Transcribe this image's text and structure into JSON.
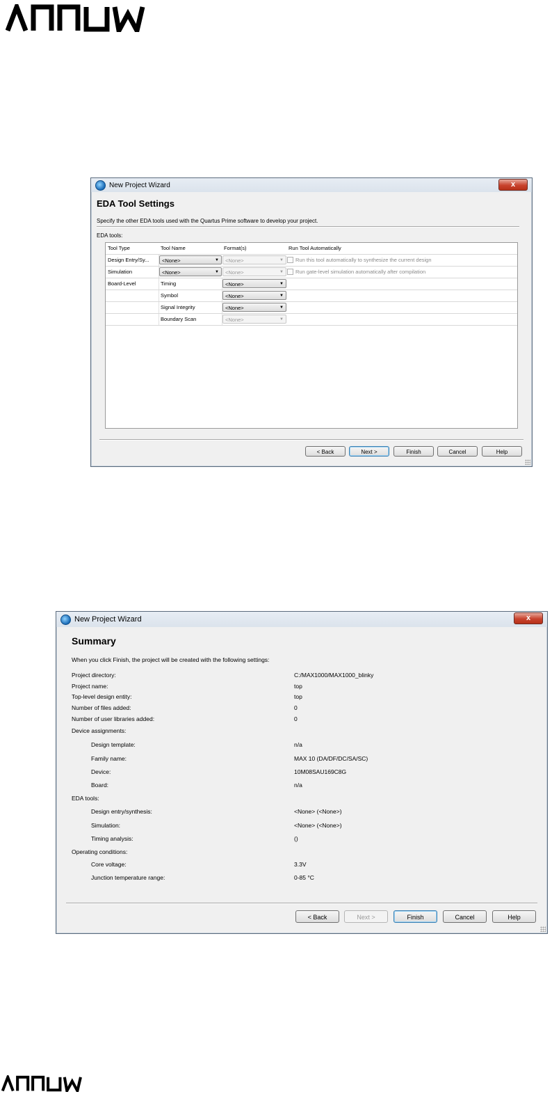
{
  "brand": {
    "logo_text": "ARROW"
  },
  "eda_window": {
    "title": "New Project Wizard",
    "close_label": "x",
    "heading": "EDA Tool Settings",
    "description": "Specify the other EDA tools used with the Quartus Prime software to develop your project.",
    "section_label": "EDA tools:",
    "columns": [
      "Tool Type",
      "Tool Name",
      "Format(s)",
      "Run Tool Automatically"
    ],
    "rows": [
      {
        "type": "Design Entry/Sy...",
        "name": "<None>",
        "format": "<None>",
        "run": "Run this tool automatically to synthesize the current design"
      },
      {
        "type": "Simulation",
        "name": "<None>",
        "format": "<None>",
        "run": "Run gate-level simulation automatically after compilation"
      },
      {
        "type": "Board-Level",
        "name": "Timing",
        "format": "<None>",
        "run": ""
      },
      {
        "type": "",
        "name": "Symbol",
        "format": "<None>",
        "run": ""
      },
      {
        "type": "",
        "name": "Signal Integrity",
        "format": "<None>",
        "run": ""
      },
      {
        "type": "",
        "name": "Boundary Scan",
        "format": "<None>",
        "run": ""
      }
    ],
    "buttons": {
      "back": "< Back",
      "next": "Next >",
      "finish": "Finish",
      "cancel": "Cancel",
      "help": "Help"
    }
  },
  "summary_window": {
    "title": "New Project Wizard",
    "close_label": "x",
    "heading": "Summary",
    "intro": "When you click Finish, the project will be created with the following settings:",
    "items": [
      {
        "label": "Project directory:",
        "value": "C:/MAX1000/MAX1000_blinky"
      },
      {
        "label": "Project name:",
        "value": "top"
      },
      {
        "label": "Top-level design entity:",
        "value": "top"
      },
      {
        "label": "Number of files added:",
        "value": "0"
      },
      {
        "label": "Number of user libraries added:",
        "value": "0"
      },
      {
        "label": "Device assignments:",
        "value": ""
      },
      {
        "label": "Design template:",
        "value": "n/a"
      },
      {
        "label": "Family name:",
        "value": "MAX 10 (DA/DF/DC/SA/SC)"
      },
      {
        "label": "Device:",
        "value": "10M08SAU169C8G"
      },
      {
        "label": "Board:",
        "value": "n/a"
      },
      {
        "label": "EDA tools:",
        "value": ""
      },
      {
        "label": "Design entry/synthesis:",
        "value": "<None> (<None>)"
      },
      {
        "label": "Simulation:",
        "value": "<None> (<None>)"
      },
      {
        "label": "Timing analysis:",
        "value": " ()"
      },
      {
        "label": "Operating conditions:",
        "value": ""
      },
      {
        "label": "Core voltage:",
        "value": "3.3V"
      },
      {
        "label": "Junction temperature range:",
        "value": "0-85 °C"
      }
    ],
    "buttons": {
      "back": "< Back",
      "next": "Next >",
      "finish": "Finish",
      "cancel": "Cancel",
      "help": "Help"
    }
  }
}
